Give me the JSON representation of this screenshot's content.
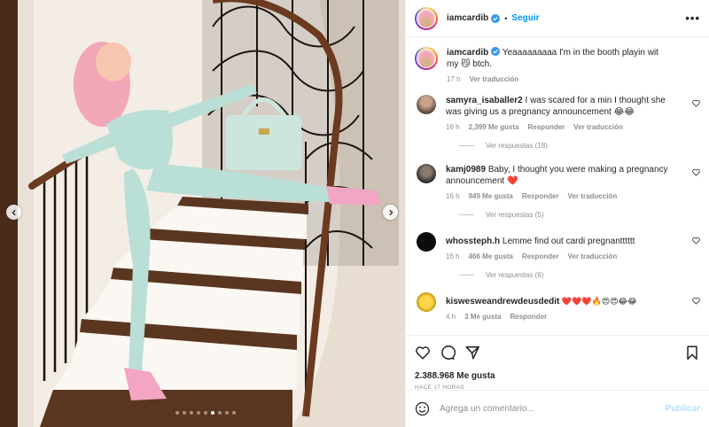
{
  "post": {
    "username": "iamcardib",
    "follow_label": "Seguir",
    "separator": "•",
    "more_label": "•••"
  },
  "caption": {
    "username": "iamcardib",
    "text": " Yeaaaaaaaaa I'm in the booth playin wit my 😼 btch.",
    "age": "17 h",
    "translate": "Ver traducción"
  },
  "comments": [
    {
      "username": "samyra_isaballer2",
      "text": " I was scared for a min I thought she was giving us a pregnancy announcement 😂😂",
      "age": "16 h",
      "likes": "2,399 Me gusta",
      "reply": "Responder",
      "translate": "Ver traducción",
      "replies": "Ver respuestas (18)"
    },
    {
      "username": "kamj0989",
      "text": " Baby, I thought you were making a pregnancy announcement ❤️",
      "age": "16 h",
      "likes": "949 Me gusta",
      "reply": "Responder",
      "translate": "Ver traducción",
      "replies": "Ver respuestas (5)"
    },
    {
      "username": "whossteph.h",
      "text": " Lemme find out cardi pregnantttttt",
      "age": "16 h",
      "likes": "466 Me gusta",
      "reply": "Responder",
      "translate": "Ver traducción",
      "replies": "Ver respuestas (6)"
    },
    {
      "username": "kiswesweandrewdeusdedit",
      "text": " ❤️❤️❤️🔥😍😍😂😂",
      "age": "4 h",
      "likes": "3 Me gusta",
      "reply": "Responder"
    }
  ],
  "actions": {
    "likes_count": "2.388.968 Me gusta",
    "time_ago": "HACE 17 HORAS"
  },
  "composer": {
    "placeholder": "Agrega un comentario...",
    "publish_label": "Publicar"
  },
  "carousel": {
    "total": 9,
    "active_index": 5
  },
  "icons": {
    "verified": "verified-badge-icon",
    "more": "more-options-icon",
    "like": "heart-icon",
    "comment": "comment-icon",
    "share": "share-icon",
    "save": "bookmark-icon",
    "emoji": "emoji-icon",
    "prev": "chevron-left-icon",
    "next": "chevron-right-icon"
  },
  "colors": {
    "accent": "#0095f6",
    "verified": "#3897f0",
    "muted": "#8e8e8e",
    "publish_disabled": "#b2dffc"
  }
}
